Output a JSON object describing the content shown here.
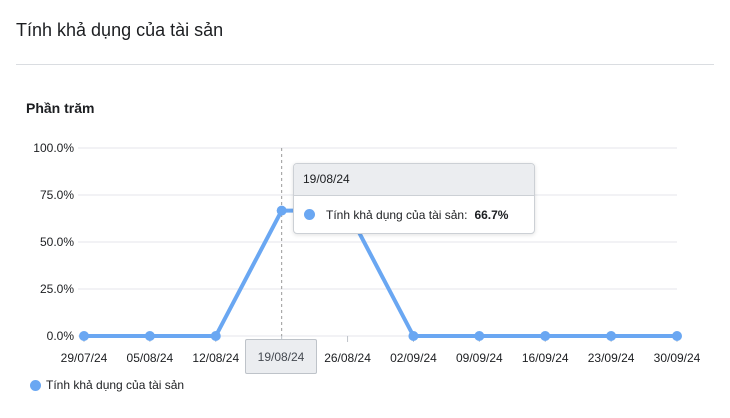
{
  "panel": {
    "title": "Tính khả dụng của tài sản"
  },
  "colors": {
    "series": "#6aa7f2",
    "grid": "#e4e6eb",
    "crosshair": "#999999"
  },
  "chart_data": {
    "type": "line",
    "ylabel": "Phần trăm",
    "ylim": [
      0,
      100
    ],
    "yticks": [
      0,
      25,
      50,
      75,
      100
    ],
    "ytick_labels": [
      "0.0%",
      "25.0%",
      "50.0%",
      "75.0%",
      "100.0%"
    ],
    "categories": [
      "29/07/24",
      "05/08/24",
      "12/08/24",
      "19/08/24",
      "26/08/24",
      "02/09/24",
      "09/09/24",
      "16/09/24",
      "23/09/24",
      "30/09/24"
    ],
    "series": [
      {
        "name": "Tính khả dụng của tài sản",
        "values": [
          0,
          0,
          0,
          66.7,
          66.7,
          0,
          0,
          0,
          0,
          0
        ]
      }
    ],
    "grid": true,
    "legend": "bottom-left"
  },
  "tooltip": {
    "date": "19/08/24",
    "series_name": "Tính khả dụng của tài sản:",
    "value": "66.7%"
  },
  "hover_x_label": "19/08/24"
}
